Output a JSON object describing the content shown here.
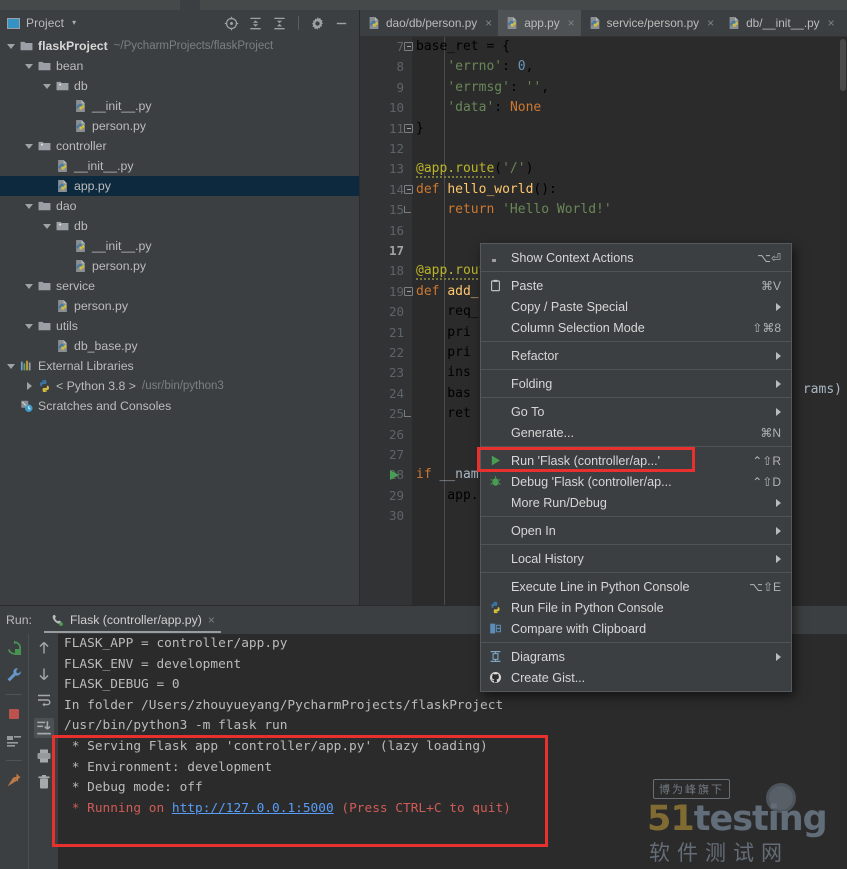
{
  "project_panel": {
    "title": "Project",
    "caret": "▾",
    "tools": [
      {
        "name": "locate-icon",
        "label": "Select Opened File"
      },
      {
        "name": "expand-all-icon",
        "label": "Expand All"
      },
      {
        "name": "collapse-all-icon",
        "label": "Collapse All"
      },
      {
        "name": "gear-icon",
        "label": "Settings"
      },
      {
        "name": "minimize-icon",
        "label": "Hide"
      }
    ],
    "tree": [
      {
        "label": "flaskProject",
        "path": "~/PycharmProjects/flaskProject",
        "depth": 0,
        "arrow": "down",
        "icon": "folder-project",
        "bold": true,
        "selected": false
      },
      {
        "label": "bean",
        "path": "",
        "depth": 1,
        "arrow": "down",
        "icon": "folder",
        "bold": false,
        "selected": false
      },
      {
        "label": "db",
        "path": "",
        "depth": 2,
        "arrow": "down",
        "icon": "folder-package",
        "bold": false,
        "selected": false
      },
      {
        "label": "__init__.py",
        "path": "",
        "depth": 3,
        "arrow": "none",
        "icon": "python-file",
        "bold": false,
        "selected": false
      },
      {
        "label": "person.py",
        "path": "",
        "depth": 3,
        "arrow": "none",
        "icon": "python-file",
        "bold": false,
        "selected": false
      },
      {
        "label": "controller",
        "path": "",
        "depth": 1,
        "arrow": "down",
        "icon": "folder-package",
        "bold": false,
        "selected": false
      },
      {
        "label": "__init__.py",
        "path": "",
        "depth": 2,
        "arrow": "none",
        "icon": "python-file",
        "bold": false,
        "selected": false
      },
      {
        "label": "app.py",
        "path": "",
        "depth": 2,
        "arrow": "none",
        "icon": "python-file",
        "bold": false,
        "selected": true
      },
      {
        "label": "dao",
        "path": "",
        "depth": 1,
        "arrow": "down",
        "icon": "folder",
        "bold": false,
        "selected": false
      },
      {
        "label": "db",
        "path": "",
        "depth": 2,
        "arrow": "down",
        "icon": "folder-package",
        "bold": false,
        "selected": false
      },
      {
        "label": "__init__.py",
        "path": "",
        "depth": 3,
        "arrow": "none",
        "icon": "python-file",
        "bold": false,
        "selected": false
      },
      {
        "label": "person.py",
        "path": "",
        "depth": 3,
        "arrow": "none",
        "icon": "python-file",
        "bold": false,
        "selected": false
      },
      {
        "label": "service",
        "path": "",
        "depth": 1,
        "arrow": "down",
        "icon": "folder",
        "bold": false,
        "selected": false
      },
      {
        "label": "person.py",
        "path": "",
        "depth": 2,
        "arrow": "none",
        "icon": "python-file",
        "bold": false,
        "selected": false
      },
      {
        "label": "utils",
        "path": "",
        "depth": 1,
        "arrow": "down",
        "icon": "folder",
        "bold": false,
        "selected": false
      },
      {
        "label": "db_base.py",
        "path": "",
        "depth": 2,
        "arrow": "none",
        "icon": "python-file",
        "bold": false,
        "selected": false
      },
      {
        "label": "External Libraries",
        "path": "",
        "depth": 0,
        "arrow": "down",
        "icon": "libraries",
        "bold": false,
        "selected": false
      },
      {
        "label": "< Python 3.8 >",
        "path": "/usr/bin/python3",
        "depth": 1,
        "arrow": "right",
        "icon": "python-logo",
        "bold": false,
        "selected": false
      },
      {
        "label": "Scratches and Consoles",
        "path": "",
        "depth": 0,
        "arrow": "none",
        "icon": "scratches",
        "bold": false,
        "selected": false
      }
    ]
  },
  "editor": {
    "tabs": [
      {
        "label": "dao/db/person.py",
        "active": false,
        "icon": "python-file"
      },
      {
        "label": "app.py",
        "active": true,
        "icon": "python-file"
      },
      {
        "label": "service/person.py",
        "active": false,
        "icon": "python-file"
      },
      {
        "label": "db/__init__.py",
        "active": false,
        "icon": "python-file"
      }
    ],
    "close_glyph": "×",
    "lines": [
      {
        "num": "7",
        "text": "base_ret = {",
        "fold": "start",
        "current": false,
        "run": false
      },
      {
        "num": "8",
        "text": "    'errno': 0,",
        "fold": "",
        "current": false,
        "run": false
      },
      {
        "num": "9",
        "text": "    'errmsg': '',",
        "fold": "",
        "current": false,
        "run": false
      },
      {
        "num": "10",
        "text": "    'data': None",
        "fold": "",
        "current": false,
        "run": false
      },
      {
        "num": "11",
        "text": "}",
        "fold": "end-box",
        "current": false,
        "run": false
      },
      {
        "num": "12",
        "text": "",
        "fold": "",
        "current": false,
        "run": false
      },
      {
        "num": "13",
        "text": "@app.route('/')",
        "fold": "",
        "current": false,
        "run": false
      },
      {
        "num": "14",
        "text": "def hello_world():",
        "fold": "start",
        "current": false,
        "run": false
      },
      {
        "num": "15",
        "text": "    return 'Hello World!'",
        "fold": "end",
        "current": false,
        "run": false
      },
      {
        "num": "16",
        "text": "",
        "fold": "",
        "current": false,
        "run": false
      },
      {
        "num": "17",
        "text": "",
        "fold": "",
        "current": true,
        "run": false
      },
      {
        "num": "18",
        "text": "@app.route",
        "fold": "",
        "current": false,
        "run": false
      },
      {
        "num": "19",
        "text": "def add_",
        "fold": "start",
        "current": false,
        "run": false
      },
      {
        "num": "20",
        "text": "    req_",
        "fold": "",
        "current": false,
        "run": false
      },
      {
        "num": "21",
        "text": "    pri",
        "fold": "",
        "current": false,
        "run": false
      },
      {
        "num": "22",
        "text": "    pri",
        "fold": "",
        "current": false,
        "run": false
      },
      {
        "num": "23",
        "text": "    ins",
        "fold": "",
        "current": false,
        "run": false
      },
      {
        "num": "24",
        "text": "    bas",
        "fold": "",
        "current": false,
        "run": false
      },
      {
        "num": "25",
        "text": "    ret",
        "fold": "end",
        "current": false,
        "run": false
      },
      {
        "num": "26",
        "text": "",
        "fold": "",
        "current": false,
        "run": false
      },
      {
        "num": "27",
        "text": "",
        "fold": "",
        "current": false,
        "run": false
      },
      {
        "num": "28",
        "text": "if __nam",
        "fold": "",
        "current": false,
        "run": true
      },
      {
        "num": "29",
        "text": "    app.",
        "fold": "",
        "current": false,
        "run": false
      },
      {
        "num": "30",
        "text": "",
        "fold": "",
        "current": false,
        "run": false
      }
    ],
    "tooltip_fragment": "rams)"
  },
  "context_menu": {
    "items": [
      {
        "label": "Show Context Actions",
        "shortcut": "⌥⏎",
        "icon": "lightbulb-icon",
        "submenu": false,
        "highlighted": false
      },
      {
        "type": "separator"
      },
      {
        "label": "Paste",
        "shortcut": "⌘V",
        "icon": "clipboard-icon",
        "submenu": false,
        "highlighted": false
      },
      {
        "label": "Copy / Paste Special",
        "shortcut": "",
        "icon": "",
        "submenu": true,
        "highlighted": false
      },
      {
        "label": "Column Selection Mode",
        "shortcut": "⇧⌘8",
        "icon": "",
        "submenu": false,
        "highlighted": false
      },
      {
        "type": "separator"
      },
      {
        "label": "Refactor",
        "shortcut": "",
        "icon": "",
        "submenu": true,
        "highlighted": false
      },
      {
        "type": "separator"
      },
      {
        "label": "Folding",
        "shortcut": "",
        "icon": "",
        "submenu": true,
        "highlighted": false
      },
      {
        "type": "separator"
      },
      {
        "label": "Go To",
        "shortcut": "",
        "icon": "",
        "submenu": true,
        "highlighted": false
      },
      {
        "label": "Generate...",
        "shortcut": "⌘N",
        "icon": "",
        "submenu": false,
        "highlighted": false
      },
      {
        "type": "separator"
      },
      {
        "label": "Run 'Flask (controller/ap...'",
        "shortcut": "⌃⇧R",
        "icon": "run-icon",
        "submenu": false,
        "highlighted": true
      },
      {
        "label": "Debug 'Flask (controller/ap...",
        "shortcut": "⌃⇧D",
        "icon": "debug-icon",
        "submenu": false,
        "highlighted": false
      },
      {
        "label": "More Run/Debug",
        "shortcut": "",
        "icon": "",
        "submenu": true,
        "highlighted": false
      },
      {
        "type": "separator"
      },
      {
        "label": "Open In",
        "shortcut": "",
        "icon": "",
        "submenu": true,
        "highlighted": false
      },
      {
        "type": "separator"
      },
      {
        "label": "Local History",
        "shortcut": "",
        "icon": "",
        "submenu": true,
        "highlighted": false
      },
      {
        "type": "separator"
      },
      {
        "label": "Execute Line in Python Console",
        "shortcut": "⌥⇧E",
        "icon": "",
        "submenu": false,
        "highlighted": false
      },
      {
        "label": "Run File in Python Console",
        "shortcut": "",
        "icon": "python-logo-icon",
        "submenu": false,
        "highlighted": false
      },
      {
        "label": "Compare with Clipboard",
        "shortcut": "",
        "icon": "compare-icon",
        "submenu": false,
        "highlighted": false
      },
      {
        "type": "separator"
      },
      {
        "label": "Diagrams",
        "shortcut": "",
        "icon": "diagram-icon",
        "submenu": true,
        "highlighted": false
      },
      {
        "label": "Create Gist...",
        "shortcut": "",
        "icon": "github-icon",
        "submenu": false,
        "highlighted": false
      }
    ],
    "highlight_color": "#e8312f"
  },
  "run_panel": {
    "run_label": "Run:",
    "tab_name": "Flask (controller/app.py)",
    "tab_close": "×",
    "left_tools": [
      {
        "name": "rerun-icon"
      },
      {
        "name": "wrench-icon"
      },
      {
        "name": "stop-icon"
      },
      {
        "name": "layout-icon"
      },
      {
        "name": "pin-icon"
      }
    ],
    "left_tools2": [
      {
        "name": "up-arrow-icon"
      },
      {
        "name": "down-arrow-icon"
      },
      {
        "name": "soft-wrap-icon"
      },
      {
        "name": "scroll-to-end-icon",
        "active": true
      },
      {
        "name": "print-icon"
      },
      {
        "name": "trash-icon"
      }
    ],
    "console": [
      {
        "text": "FLASK_APP = controller/app.py",
        "style": "normal"
      },
      {
        "text": "FLASK_ENV = development",
        "style": "normal"
      },
      {
        "text": "FLASK_DEBUG = 0",
        "style": "normal"
      },
      {
        "text": "In folder /Users/zhouyueyang/PycharmProjects/flaskProject",
        "style": "normal"
      },
      {
        "text": "/usr/bin/python3 -m flask run",
        "style": "normal"
      },
      {
        "text": " * Serving Flask app 'controller/app.py' (lazy loading)",
        "style": "normal"
      },
      {
        "text": " * Environment: development",
        "style": "normal"
      },
      {
        "text": " * Debug mode: off",
        "style": "normal"
      },
      {
        "prefix": " * Running on ",
        "link": "http://127.0.0.1:5000",
        "suffix": " (Press CTRL+C to quit)",
        "style": "error"
      }
    ],
    "highlight_color": "#e8312f"
  },
  "watermark": {
    "badge": "博为峰旗下",
    "main_a": "51",
    "main_b": "testing",
    "sub": "软件测试网"
  },
  "colors": {
    "panel_bg": "#3c3f41",
    "editor_bg": "#2b2b2b",
    "gutter_bg": "#313335",
    "selection": "#0d293e",
    "accent_red": "#e8312f",
    "link_blue": "#589df6",
    "keyword": "#cc7832",
    "string": "#6a8759",
    "decorator": "#bbb529"
  }
}
